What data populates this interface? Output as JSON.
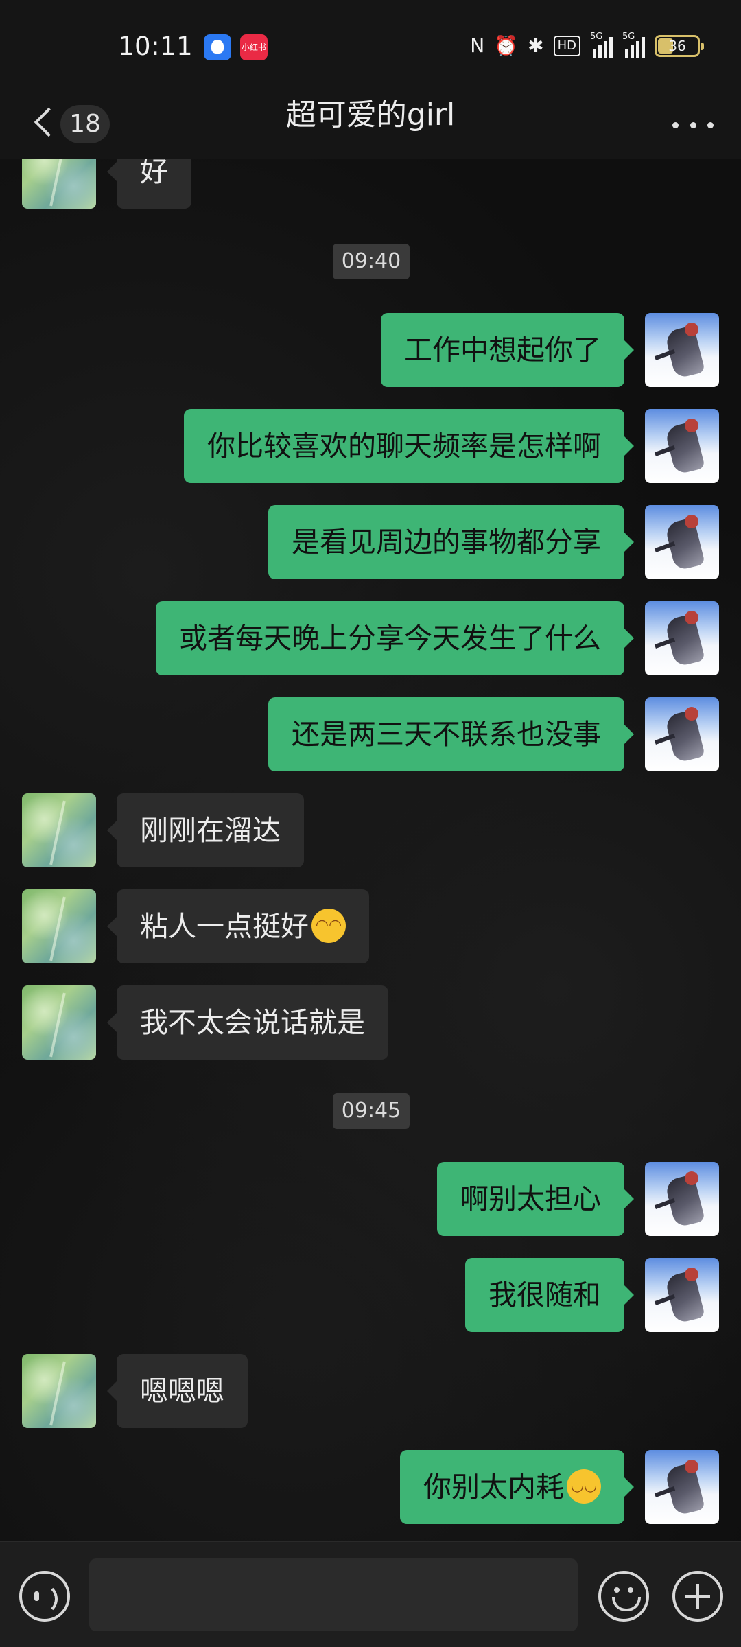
{
  "status_bar": {
    "time": "10:11",
    "notifications": [
      "qq-icon",
      "xiaohongshu-icon"
    ],
    "xhs_label": "小红书",
    "nfc_glyph": "N",
    "alarm_glyph": "⏰",
    "bluetooth_glyph": "✱",
    "hd_label": "HD",
    "signal_1_label": "5G",
    "signal_2_label": "5G",
    "battery_level": "36",
    "battery_color": "#d8c06a"
  },
  "nav": {
    "unread_count": "18",
    "title": "超可爱的girl"
  },
  "messages": [
    {
      "side": "peer",
      "text": "好"
    },
    {
      "time": "09:40"
    },
    {
      "side": "self",
      "text": "工作中想起你了"
    },
    {
      "side": "self",
      "text": "你比较喜欢的聊天频率是怎样啊"
    },
    {
      "side": "self",
      "text": "是看见周边的事物都分享"
    },
    {
      "side": "self",
      "text": "或者每天晚上分享今天发生了什么"
    },
    {
      "side": "self",
      "text": "还是两三天不联系也没事"
    },
    {
      "side": "peer",
      "text": "刚刚在溜达"
    },
    {
      "side": "peer",
      "text": "粘人一点挺好",
      "emoji": "shy-face-emoji"
    },
    {
      "side": "peer",
      "text": "我不太会说话就是"
    },
    {
      "time": "09:45"
    },
    {
      "side": "self",
      "text": "啊别太担心"
    },
    {
      "side": "self",
      "text": "我很随和"
    },
    {
      "side": "peer",
      "text": "嗯嗯嗯"
    },
    {
      "side": "self",
      "text": "你别太内耗",
      "emoji": "tears-of-joy-emoji"
    }
  ],
  "emoji_glyphs": {
    "shy": "◠◠",
    "joy": "◡◡"
  },
  "input_bar": {
    "value": "",
    "icons": [
      "voice-icon",
      "emoji-icon",
      "plus-icon"
    ]
  },
  "colors": {
    "self_bubble": "#3eb575",
    "peer_bubble": "#2c2c2c",
    "background": "#111111"
  }
}
